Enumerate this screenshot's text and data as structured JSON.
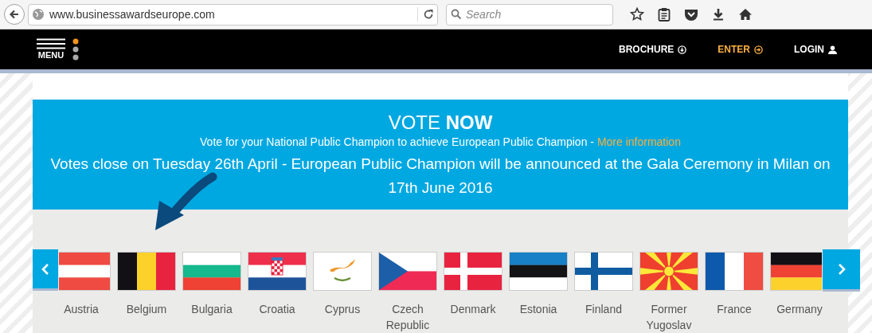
{
  "browser": {
    "url": "www.businessawardseurope.com",
    "search": {
      "placeholder": "Search"
    }
  },
  "nav": {
    "menu_label": "MENU",
    "items": [
      {
        "label": "BROCHURE",
        "highlighted": false,
        "kind": "download"
      },
      {
        "label": "ENTER",
        "highlighted": true,
        "kind": "enter"
      },
      {
        "label": "LOGIN",
        "highlighted": false,
        "kind": "user"
      }
    ]
  },
  "banner": {
    "title": "VOTE **NOW**",
    "subtitle": "Vote for your National Public Champion to achieve European Public Champion - ",
    "link": "More information",
    "notice": "Votes close on Tuesday 26th April - European Public Champion will be announced at the Gala Ceremony in Milan on 17th June 2016"
  },
  "countries": [
    {
      "name": "Austria"
    },
    {
      "name": "Belgium"
    },
    {
      "name": "Bulgaria"
    },
    {
      "name": "Croatia"
    },
    {
      "name": "Cyprus"
    },
    {
      "name": "Czech Republic"
    },
    {
      "name": "Denmark"
    },
    {
      "name": "Estonia"
    },
    {
      "name": "Finland"
    },
    {
      "name": "Former Yugoslav"
    },
    {
      "name": "France"
    },
    {
      "name": "Germany"
    }
  ]
}
